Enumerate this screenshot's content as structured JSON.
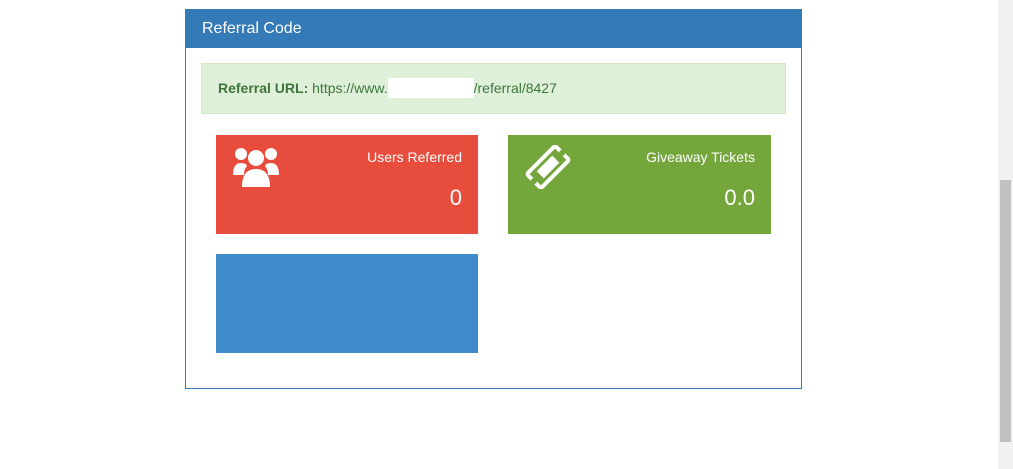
{
  "panel": {
    "title": "Referral Code"
  },
  "referral": {
    "label": "Referral URL:",
    "url_prefix": "https://www.",
    "url_suffix": "/referral/8427"
  },
  "tiles": [
    {
      "icon": "users-icon",
      "label": "Users Referred",
      "value": "0",
      "color": "#e74c3c"
    },
    {
      "icon": "ticket-icon",
      "label": "Giveaway Tickets",
      "value": "0.0",
      "color": "#74a63b"
    },
    {
      "color": "#3f8bcb"
    }
  ],
  "colors": {
    "primary": "#337ab7",
    "success_bg": "#dff0d8",
    "success_text": "#3c763d"
  }
}
